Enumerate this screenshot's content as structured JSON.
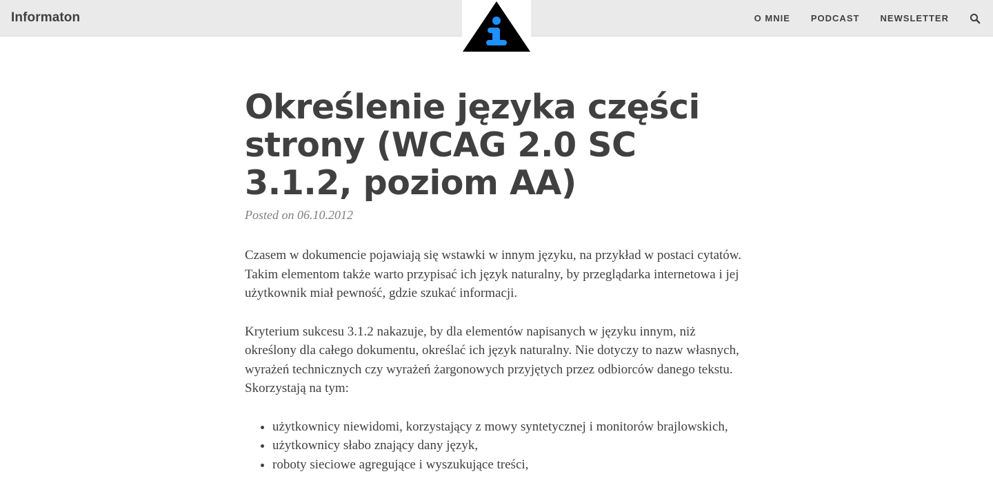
{
  "header": {
    "brand": "Informaton",
    "logo_icon": "info-triangle-icon",
    "nav": [
      {
        "label": "O MNIE"
      },
      {
        "label": "PODCAST"
      },
      {
        "label": "NEWSLETTER"
      }
    ],
    "search_icon": "search-icon"
  },
  "post": {
    "title": "Określenie języka części strony (WCAG 2.0 SC 3.1.2, poziom AA)",
    "meta": "Posted on 06.10.2012",
    "paragraphs": [
      "Czasem w dokumencie pojawiają się wstawki w innym języku, na przykład w postaci cytatów. Takim elementom także warto przypisać ich język naturalny, by przeglądarka internetowa i jej użytkownik miał pewność, gdzie szukać informacji.",
      "Kryterium sukcesu 3.1.2 nakazuje, by dla elementów napisanych w języku innym, niż określony dla całego dokumentu, określać ich język naturalny. Nie dotyczy to nazw własnych, wyrażeń technicznych czy wyrażeń żargonowych przyjętych przez odbiorców danego tekstu. Skorzystają na tym:"
    ],
    "list": [
      "użytkownicy niewidomi, korzystający z mowy syntetycznej i monitorów brajlowskich,",
      "użytkownicy słabo znający dany język,",
      "roboty sieciowe agregujące i wyszukujące treści,"
    ]
  },
  "colors": {
    "topbar_bg": "#eaeaea",
    "text": "#404040",
    "meta": "#808080",
    "logo_accent": "#1e90ff"
  }
}
